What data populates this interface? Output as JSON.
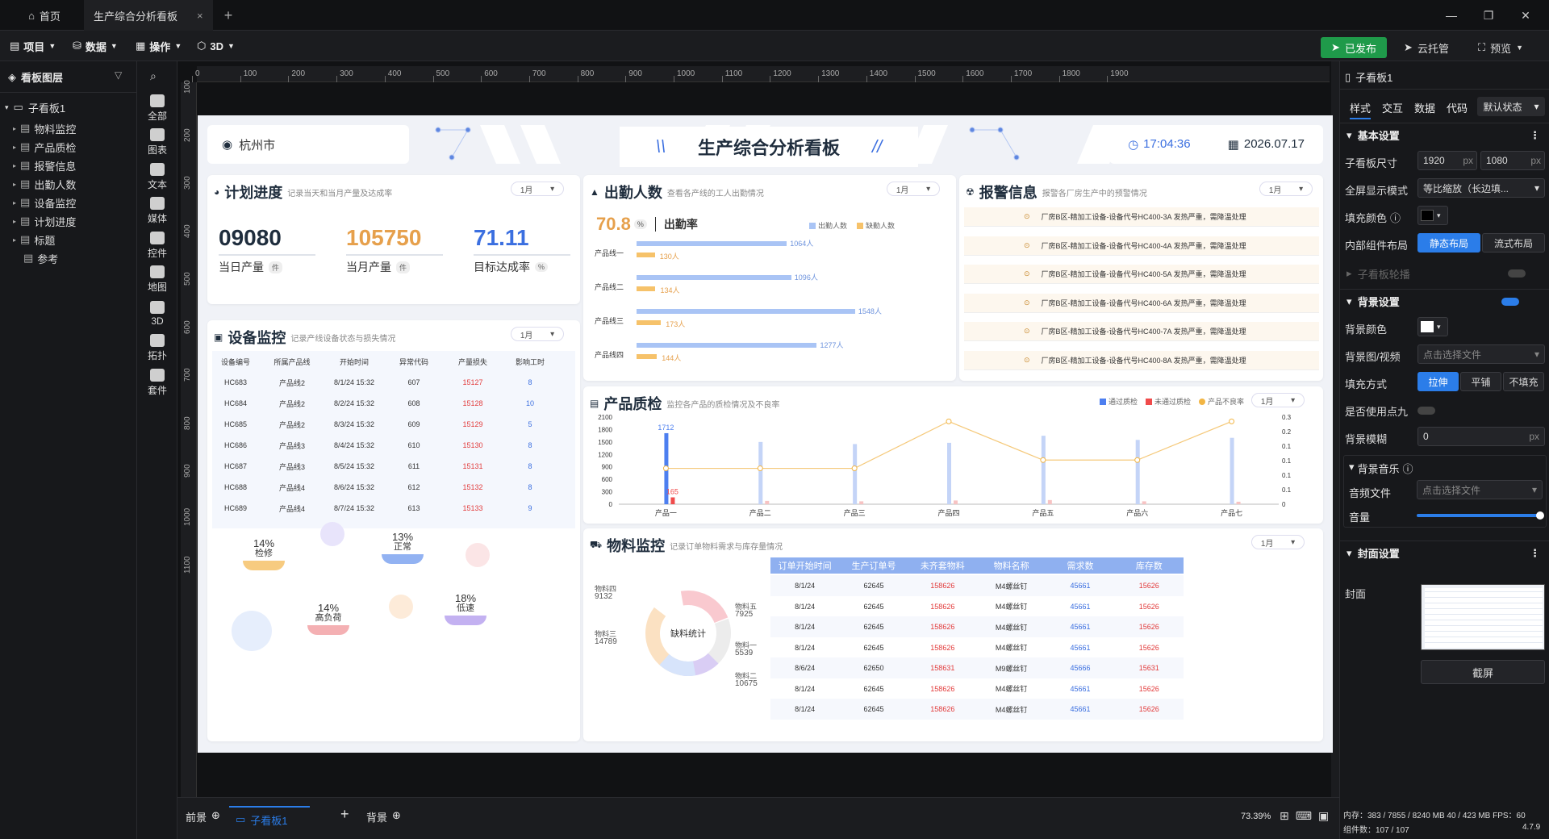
{
  "tabs": {
    "home": "首页",
    "doc": "生产综合分析看板",
    "add": "+"
  },
  "toolbar": {
    "project": "项目",
    "data": "数据",
    "operate": "操作",
    "three_d": "3D",
    "publish": "已发布",
    "cloud": "云托管",
    "preview": "预览"
  },
  "layers": {
    "title": "看板图层",
    "root": "子看板1",
    "items": [
      "物料监控",
      "产品质检",
      "报警信息",
      "出勤人数",
      "设备监控",
      "计划进度",
      "标题",
      "参考"
    ]
  },
  "iconbar": [
    "全部",
    "图表",
    "文本",
    "媒体",
    "控件",
    "地图",
    "3D",
    "拓扑",
    "套件"
  ],
  "ruler": {
    "h": [
      "0",
      "100",
      "200",
      "300",
      "400",
      "500",
      "600",
      "700",
      "800",
      "900",
      "1000",
      "1100",
      "1200",
      "1300",
      "1400",
      "1500",
      "1600",
      "1700",
      "1800",
      "1900"
    ],
    "v": [
      "100",
      "200",
      "300",
      "400",
      "500",
      "600",
      "700",
      "800",
      "900",
      "1000",
      "1100"
    ]
  },
  "header": {
    "city": "杭州市",
    "title": "生产综合分析看板",
    "time": "17:04:36",
    "date": "2026.07.17"
  },
  "plan": {
    "title": "计划进度",
    "subtitle": "记录当天和当月产量及达成率",
    "month": "1月",
    "kpis": [
      {
        "value": "09080",
        "label": "当日产量",
        "unit": "件",
        "color": "#1f2d3d"
      },
      {
        "value": "105750",
        "label": "当月产量",
        "unit": "件",
        "color": "#e6a04c"
      },
      {
        "value": "71.11",
        "label": "目标达成率",
        "unit": "%",
        "color": "#3b6fe0"
      }
    ]
  },
  "attendance": {
    "title": "出勤人数",
    "subtitle": "查看各产线的工人出勤情况",
    "month": "1月",
    "rate": "70.8",
    "rate_unit": "%",
    "rate_label": "出勤率",
    "legend": [
      "出勤人数",
      "缺勤人数"
    ],
    "lines": [
      {
        "name": "产品线一",
        "present": 1064,
        "absent": 130,
        "present_label": "1064人",
        "absent_label": "130人"
      },
      {
        "name": "产品线二",
        "present": 1096,
        "absent": 134,
        "present_label": "1096人",
        "absent_label": "134人"
      },
      {
        "name": "产品线三",
        "present": 1548,
        "absent": 173,
        "present_label": "1548人",
        "absent_label": "173人"
      },
      {
        "name": "产品线四",
        "present": 1277,
        "absent": 144,
        "present_label": "1277人",
        "absent_label": "144人"
      }
    ]
  },
  "alarm": {
    "title": "报警信息",
    "subtitle": "报警各厂房生产中的预警情况",
    "month": "1月",
    "items": [
      "厂房B区-精加工设备-设备代号HC400-3A 发热严重，需降温处理",
      "厂房B区-精加工设备-设备代号HC400-4A 发热严重，需降温处理",
      "厂房B区-精加工设备-设备代号HC400-5A 发热严重，需降温处理",
      "厂房B区-精加工设备-设备代号HC400-6A 发热严重，需降温处理",
      "厂房B区-精加工设备-设备代号HC400-7A 发热严重，需降温处理",
      "厂房B区-精加工设备-设备代号HC400-8A 发热严重，需降温处理"
    ]
  },
  "equipment": {
    "title": "设备监控",
    "subtitle": "记录产线设备状态与损失情况",
    "month": "1月",
    "headers": [
      "设备编号",
      "所属产品线",
      "开始时间",
      "异常代码",
      "产量损失",
      "影响工时"
    ],
    "rows": [
      [
        "HC683",
        "产品线2",
        "8/1/24 15:32",
        "607",
        "15127",
        "8"
      ],
      [
        "HC684",
        "产品线2",
        "8/2/24 15:32",
        "608",
        "15128",
        "10"
      ],
      [
        "HC685",
        "产品线2",
        "8/3/24 15:32",
        "609",
        "15129",
        "5"
      ],
      [
        "HC686",
        "产品线3",
        "8/4/24 15:32",
        "610",
        "15130",
        "8"
      ],
      [
        "HC687",
        "产品线3",
        "8/5/24 15:32",
        "611",
        "15131",
        "8"
      ],
      [
        "HC688",
        "产品线4",
        "8/6/24 15:32",
        "612",
        "15132",
        "8"
      ],
      [
        "HC689",
        "产品线4",
        "8/7/24 15:32",
        "613",
        "15133",
        "9"
      ]
    ],
    "bubbles": [
      {
        "pct": "14%",
        "label": "检修"
      },
      {
        "pct": "13%",
        "label": "正常"
      },
      {
        "pct": "14%",
        "label": "高负荷"
      },
      {
        "pct": "18%",
        "label": "低速"
      }
    ]
  },
  "quality": {
    "title": "产品质检",
    "subtitle": "监控各产品的质检情况及不良率",
    "month": "1月",
    "legend": [
      "通过质检",
      "未通过质检",
      "产品不良率"
    ],
    "chart_data": {
      "type": "bar",
      "categories": [
        "产品一",
        "产品二",
        "产品三",
        "产品四",
        "产品五",
        "产品六",
        "产品七"
      ],
      "series": [
        {
          "name": "通过质检",
          "values": [
            1712,
            1500,
            1450,
            1480,
            1650,
            1550,
            1600
          ]
        },
        {
          "name": "未通过质检",
          "values": [
            165,
            80,
            70,
            90,
            100,
            70,
            60
          ]
        },
        {
          "name": "产品不良率",
          "values": [
            0.13,
            0.13,
            0.13,
            0.3,
            0.16,
            0.16,
            0.3
          ]
        }
      ],
      "ylim": [
        0,
        2100
      ],
      "yticks": [
        "2100",
        "1800",
        "1500",
        "1200",
        "900",
        "600",
        "300",
        "0"
      ],
      "y2ticks": [
        "0.3",
        "0.2",
        "0.1",
        "0.1",
        "0.1",
        "0.1",
        "0"
      ],
      "labels": [
        "1712",
        "165"
      ]
    }
  },
  "material": {
    "title": "物料监控",
    "subtitle": "记录订单物料需求与库存量情况",
    "month": "1月",
    "donut_center": "缺料统计",
    "donut_labels": [
      {
        "name": "物料四",
        "value": "9132"
      },
      {
        "name": "物料五",
        "value": "7925"
      },
      {
        "name": "物料三",
        "value": "14789"
      },
      {
        "name": "物料一",
        "value": "5539"
      },
      {
        "name": "物料二",
        "value": "10675"
      }
    ],
    "headers": [
      "订单开始时间",
      "生产订单号",
      "未齐套物料",
      "物料名称",
      "需求数",
      "库存数"
    ],
    "rows": [
      [
        "8/1/24",
        "62645",
        "158626",
        "M4螺丝钉",
        "45661",
        "15626"
      ],
      [
        "8/1/24",
        "62645",
        "158626",
        "M4螺丝钉",
        "45661",
        "15626"
      ],
      [
        "8/1/24",
        "62645",
        "158626",
        "M4螺丝钉",
        "45661",
        "15626"
      ],
      [
        "8/1/24",
        "62645",
        "158626",
        "M4螺丝钉",
        "45661",
        "15626"
      ],
      [
        "8/6/24",
        "62650",
        "158631",
        "M9螺丝钉",
        "45666",
        "15631"
      ],
      [
        "8/1/24",
        "62645",
        "158626",
        "M4螺丝钉",
        "45661",
        "15626"
      ],
      [
        "8/1/24",
        "62645",
        "158626",
        "M4螺丝钉",
        "45661",
        "15626"
      ]
    ]
  },
  "props": {
    "name": "子看板1",
    "tabs": [
      "样式",
      "交互",
      "数据",
      "代码"
    ],
    "state": "默认状态",
    "basic": "基本设置",
    "size_label": "子看板尺寸",
    "w": "1920",
    "h": "1080",
    "px": "px",
    "fullscreen_label": "全屏显示模式",
    "fullscreen": "等比缩放（长边填...",
    "fill_label": "填充颜色",
    "inner_label": "内部组件布局",
    "static": "静态布局",
    "flow": "流式布局",
    "carousel": "子看板轮播",
    "bg": "背景设置",
    "bgcolor_label": "背景颜色",
    "bgimg_label": "背景图/视频",
    "choose_file": "点击选择文件",
    "fillmode_label": "填充方式",
    "fill_opts": [
      "拉伸",
      "平铺",
      "不填充"
    ],
    "dot9_label": "是否使用点九",
    "blur_label": "背景模糊",
    "blur": "0",
    "music": "背景音乐",
    "audio_label": "音频文件",
    "volume_label": "音量",
    "cover": "封面设置",
    "cover_label": "封面",
    "screenshot": "截屏"
  },
  "bottom": {
    "fg": "前景",
    "tab": "子看板1",
    "bg": "背景",
    "zoom": "73.39%",
    "mem": "内存：383 / 7855 / 8240 MB  40 / 423 MB  FPS：60",
    "count": "组件数：107 / 107",
    "ver": "4.7.9"
  }
}
